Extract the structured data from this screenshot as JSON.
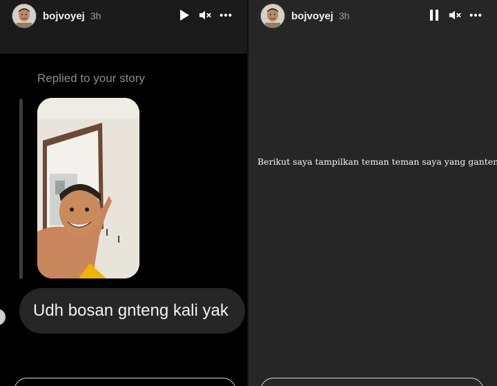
{
  "left_story": {
    "header": {
      "username": "bojvoyej",
      "time": "3h",
      "avatar_icon": "profile-avatar",
      "play_icon": "play-icon",
      "mute_icon": "muted-speaker-icon",
      "more_icon": "more-dots-icon"
    },
    "reply": {
      "label": "Replied to your story",
      "message": "Udh bosan gnteng kali yak"
    }
  },
  "right_story": {
    "header": {
      "username": "bojvoyej",
      "time": "3h",
      "avatar_icon": "profile-avatar",
      "pause_icon": "pause-icon",
      "mute_icon": "muted-speaker-icon",
      "more_icon": "more-dots-icon"
    },
    "caption": "Berikut saya tampilkan teman teman saya yang ganteng"
  },
  "colors": {
    "left_header_bg": "#1b1b1b",
    "left_body_bg": "#000000",
    "right_bg": "#262626",
    "bubble_bg": "#262626",
    "text_primary": "#f2f2f2",
    "text_muted": "#8a8a8a"
  }
}
